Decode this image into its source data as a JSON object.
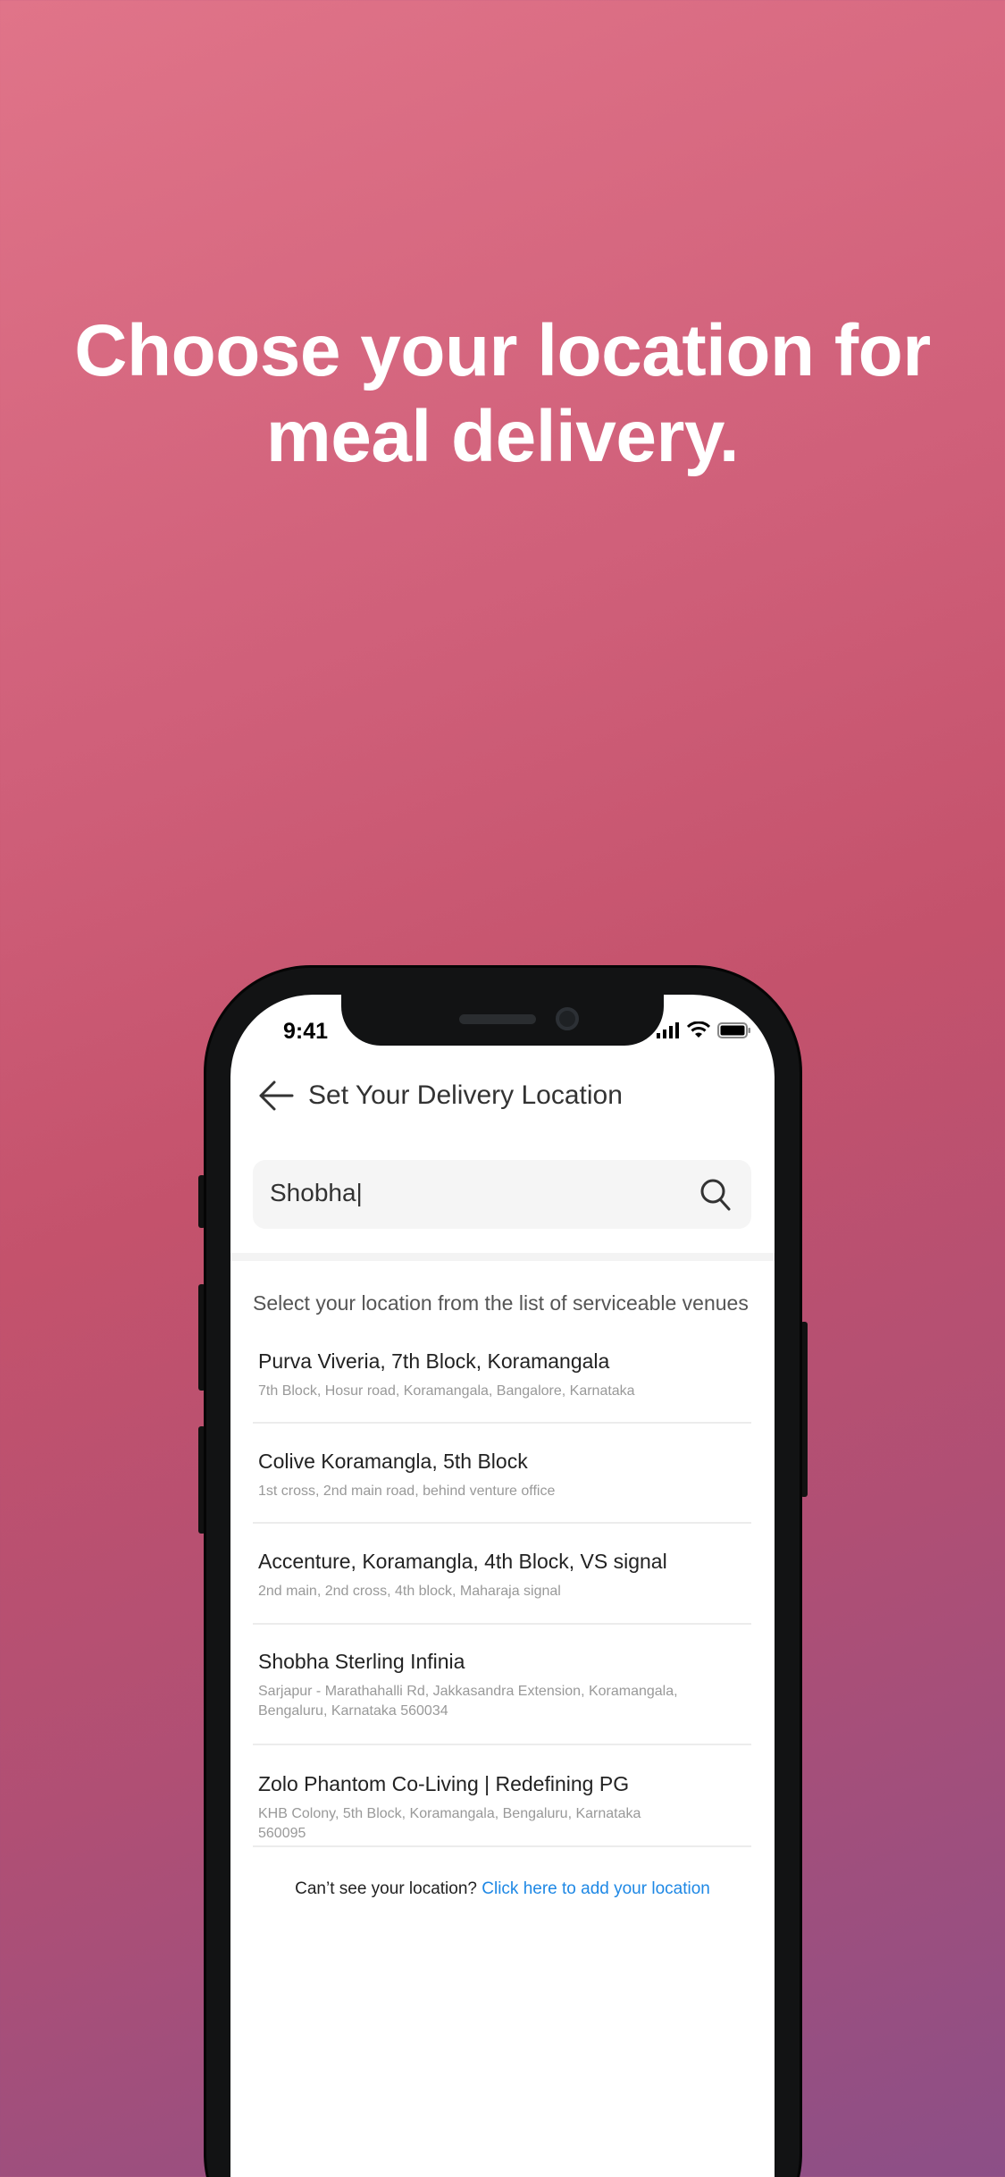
{
  "headline": {
    "line1": "Choose your location for",
    "line2": "meal delivery."
  },
  "status_bar": {
    "time": "9:41",
    "icons": [
      "signal-icon",
      "wifi-icon",
      "battery-icon"
    ]
  },
  "header": {
    "title": "Set Your Delivery Location",
    "back_icon": "arrow-left-icon"
  },
  "search": {
    "value": "Shobha|",
    "icon": "search-icon"
  },
  "instruction": "Select your location from the list of serviceable venues",
  "venues": [
    {
      "name": "Purva Viveria, 7th Block, Koramangala",
      "address": "7th Block, Hosur road, Koramangala, Bangalore, Karnataka"
    },
    {
      "name": "Colive Koramangla, 5th Block",
      "address": "1st cross, 2nd main road, behind venture office"
    },
    {
      "name": "Accenture, Koramangla, 4th Block, VS signal",
      "address": "2nd main, 2nd cross, 4th block, Maharaja signal"
    },
    {
      "name": "Shobha Sterling Infinia",
      "address": "Sarjapur - Marathahalli Rd, Jakkasandra Extension, Koramangala, Bengaluru, Karnataka 560034"
    },
    {
      "name": "Zolo Phantom Co-Living | Redefining PG",
      "address": "KHB Colony, 5th Block, Koramangala, Bengaluru, Karnataka 560095"
    }
  ],
  "footer": {
    "question": "Can’t see your location? ",
    "link": "Click here to add your location"
  },
  "colors": {
    "link": "#1e88e5",
    "background_top": "#e07489",
    "background_bottom": "#8c4f87"
  }
}
